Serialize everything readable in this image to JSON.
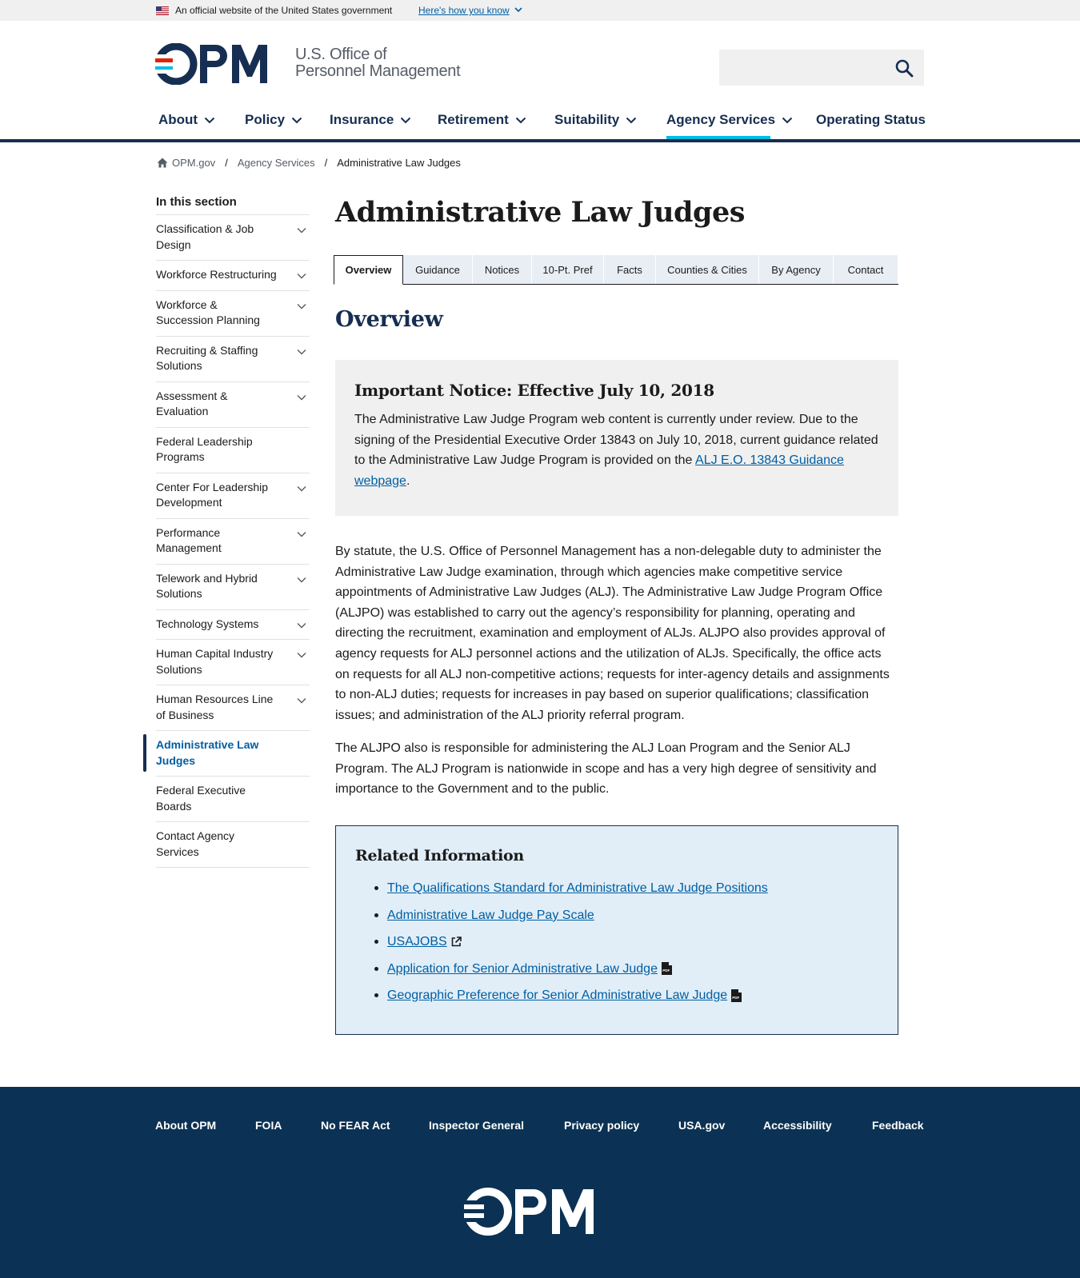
{
  "gov_banner": {
    "official_text": "An official website of the United States government",
    "how_you_know": "Here's how you know"
  },
  "header": {
    "logo_text": "OPM",
    "agency_line1": "U.S. Office of",
    "agency_line2": "Personnel Management",
    "search_placeholder": ""
  },
  "nav": {
    "items": [
      {
        "label": "About"
      },
      {
        "label": "Policy"
      },
      {
        "label": "Insurance"
      },
      {
        "label": "Retirement"
      },
      {
        "label": "Suitability"
      },
      {
        "label": "Agency Services"
      },
      {
        "label": "Operating Status"
      }
    ]
  },
  "breadcrumb": {
    "home": "OPM.gov",
    "level1": "Agency Services",
    "current": "Administrative Law Judges"
  },
  "sidenav": {
    "title": "In this section",
    "items": [
      {
        "label": "Classification & Job Design"
      },
      {
        "label": "Workforce Restructuring"
      },
      {
        "label": "Workforce & Succession Planning"
      },
      {
        "label": "Recruiting & Staffing Solutions"
      },
      {
        "label": "Assessment & Evaluation"
      },
      {
        "label": "Federal Leadership Programs"
      },
      {
        "label": "Center For Leadership Development"
      },
      {
        "label": "Performance Management"
      },
      {
        "label": "Telework and Hybrid Solutions"
      },
      {
        "label": "Technology Systems"
      },
      {
        "label": "Human Capital Industry Solutions"
      },
      {
        "label": "Human Resources Line of Business"
      },
      {
        "label": "Administrative Law Judges"
      },
      {
        "label": "Federal Executive Boards"
      },
      {
        "label": "Contact Agency Services"
      }
    ]
  },
  "main": {
    "title": "Administrative Law Judges",
    "tabs": [
      {
        "label": "Overview"
      },
      {
        "label": "Guidance"
      },
      {
        "label": "Notices"
      },
      {
        "label": "10-Pt. Pref"
      },
      {
        "label": "Facts"
      },
      {
        "label": "Counties & Cities"
      },
      {
        "label": "By Agency"
      },
      {
        "label": "Contact"
      }
    ],
    "section_heading": "Overview",
    "notice": {
      "heading": "Important Notice: Effective July 10, 2018",
      "text_before": "The Administrative Law Judge Program web content is currently under review. Due to the signing of the Presidential Executive Order 13843 on July 10, 2018, current guidance related to the Administrative Law Judge Program is provided on the ",
      "link": "ALJ E.O. 13843 Guidance webpage",
      "text_after": "."
    },
    "paragraph1": "By statute, the U.S. Office of Personnel Management has a non-delegable duty to administer the Administrative Law Judge examination, through which agencies make competitive service appointments of Administrative Law Judges (ALJ). The Administrative Law Judge Program Office (ALJPO) was established to carry out the agency’s responsibility for planning, operating and directing the recruitment, examination and employment of ALJs. ALJPO also provides approval of agency requests for ALJ personnel actions and the utilization of ALJs. Specifically, the office acts on requests for all ALJ non-competitive actions; requests for inter-agency details and assignments to non-ALJ duties; requests for increases in pay based on superior qualifications; classification issues; and administration of the ALJ priority referral program.",
    "paragraph2": "The ALJPO also is responsible for administering the ALJ Loan Program and the Senior ALJ Program. The ALJ Program is nationwide in scope and has a very high degree of sensitivity and importance to the Government and to the public.",
    "related": {
      "heading": "Related Information",
      "links": [
        {
          "label": "The Qualifications Standard for Administrative Law Judge Positions",
          "icon": ""
        },
        {
          "label": "Administrative Law Judge Pay Scale",
          "icon": ""
        },
        {
          "label": "USAJOBS",
          "icon": "external-link-icon"
        },
        {
          "label": "Application for Senior Administrative Law Judge",
          "icon": "pdf-icon"
        },
        {
          "label": "Geographic Preference for Senior Administrative Law Judge",
          "icon": "pdf-icon"
        }
      ]
    }
  },
  "footer": {
    "links": [
      {
        "label": "About OPM"
      },
      {
        "label": "FOIA"
      },
      {
        "label": "No FEAR Act"
      },
      {
        "label": "Inspector General"
      },
      {
        "label": "Privacy policy"
      },
      {
        "label": "USA.gov"
      },
      {
        "label": "Accessibility"
      },
      {
        "label": "Feedback"
      }
    ],
    "logo_text": "OPM"
  },
  "colors": {
    "navy": "#162e51",
    "link": "#005ea2",
    "accent_cyan": "#00bde3",
    "footer_bg": "#0b3254",
    "logo_red": "#e52207"
  }
}
